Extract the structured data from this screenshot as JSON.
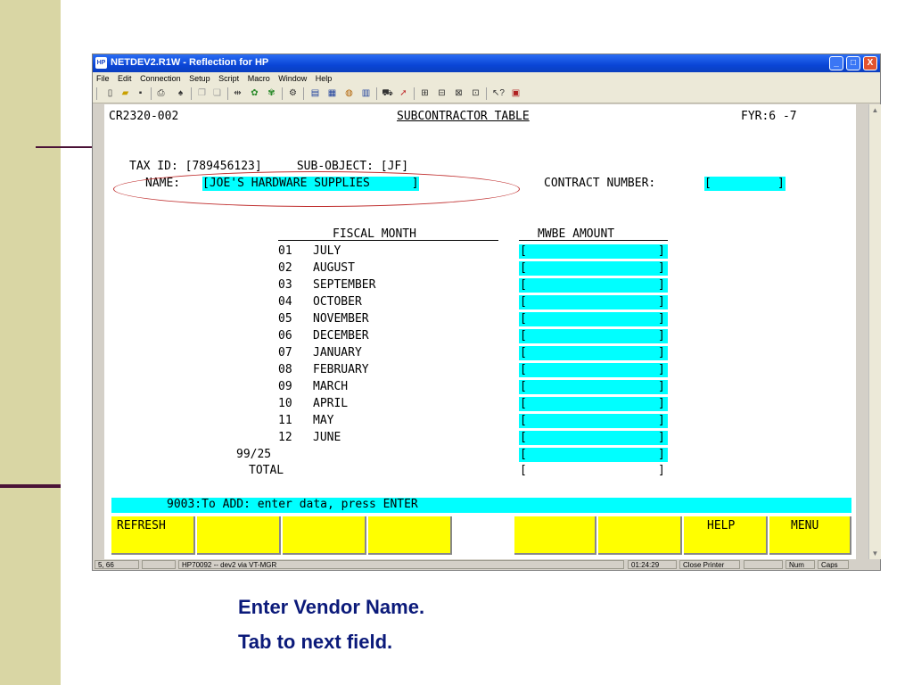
{
  "window": {
    "title": "NETDEV2.R1W - Reflection for HP",
    "icon_label": "HP",
    "controls": {
      "minimize": "_",
      "maximize": "□",
      "close": "X"
    }
  },
  "menu": [
    "File",
    "Edit",
    "Connection",
    "Setup",
    "Script",
    "Macro",
    "Window",
    "Help"
  ],
  "toolbar_icons": [
    "new-icon",
    "open-icon",
    "save-icon",
    "print-icon",
    "find-icon",
    "copy-icon",
    "paste-icon",
    "connect-icon",
    "transfer-icon",
    "receive-icon",
    "settings-icon",
    "display-icon",
    "keyboard-icon",
    "colors-icon",
    "macro-icon",
    "upload-icon",
    "cursor-icon",
    "window1-icon",
    "window2-icon",
    "window3-icon",
    "window4-icon",
    "help-pointer-icon",
    "exit-icon"
  ],
  "terminal": {
    "screen_id": "CR2320-002",
    "screen_title": "SUBCONTRACTOR TABLE",
    "fyr": "FYR:6 -7",
    "tax_id_line": "TAX ID: [789456123]     SUB-OBJECT: [JF]",
    "name_label": "NAME:",
    "name_value": "[JOE'S HARDWARE SUPPLIES      ]",
    "contract_label": "CONTRACT NUMBER:",
    "contract_value": "[         ]",
    "fiscal_month_header": "FISCAL MONTH",
    "mwbe_header": "MWBE AMOUNT",
    "months": [
      {
        "num": "01",
        "name": "JULY"
      },
      {
        "num": "02",
        "name": "AUGUST"
      },
      {
        "num": "03",
        "name": "SEPTEMBER"
      },
      {
        "num": "04",
        "name": "OCTOBER"
      },
      {
        "num": "05",
        "name": "NOVEMBER"
      },
      {
        "num": "06",
        "name": "DECEMBER"
      },
      {
        "num": "07",
        "name": "JANUARY"
      },
      {
        "num": "08",
        "name": "FEBRUARY"
      },
      {
        "num": "09",
        "name": "MARCH"
      },
      {
        "num": "10",
        "name": "APRIL"
      },
      {
        "num": "11",
        "name": "MAY"
      },
      {
        "num": "12",
        "name": "JUNE"
      },
      {
        "num": "99/25",
        "name": ""
      }
    ],
    "total_label": "TOTAL",
    "field_left_bracket": "[",
    "field_right_bracket": "]",
    "message": "9003:To ADD: enter data, press ENTER",
    "function_keys": [
      "REFRESH",
      "",
      "",
      "",
      "",
      "",
      "",
      "HELP",
      "MENU"
    ]
  },
  "statusbar": {
    "cursor_pos": "5, 66",
    "session": "HP70092 -- dev2 via VT-MGR",
    "time": "01:24:29",
    "printer": "Close Printer",
    "num": "Num",
    "caps": "Caps"
  },
  "caption": {
    "line1": "Enter Vendor Name.",
    "line2": "Tab to next field."
  }
}
